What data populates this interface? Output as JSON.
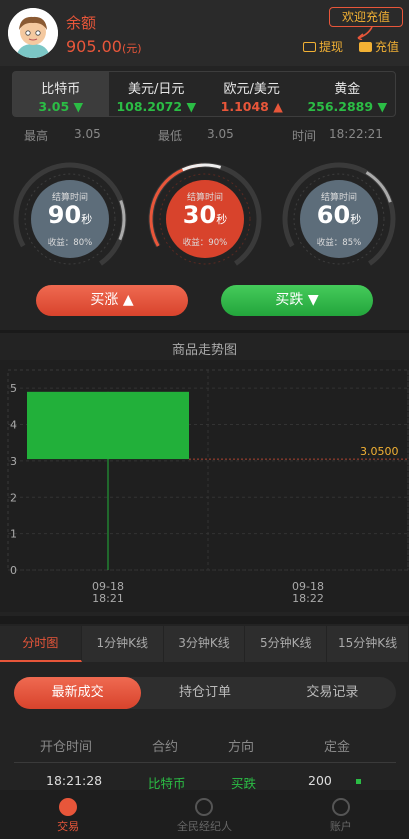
{
  "header": {
    "balance_label": "余额",
    "balance_value": "905.00",
    "balance_unit": "(元)",
    "welcome_button": "欢迎充值",
    "withdraw_label": "提现",
    "recharge_label": "充值"
  },
  "assets": [
    {
      "name": "比特币",
      "price": "3.05",
      "trend": "▼"
    },
    {
      "name": "美元/日元",
      "price": "108.2072",
      "trend": "▼"
    },
    {
      "name": "欧元/美元",
      "price": "1.1048",
      "trend": "▲"
    },
    {
      "name": "黄金",
      "price": "256.2889",
      "trend": "▼"
    }
  ],
  "stats": {
    "high_label": "最高",
    "high_value": "3.05",
    "low_label": "最低",
    "low_value": "3.05",
    "time_label": "时间",
    "time_value": "18:22:21"
  },
  "timers": [
    {
      "label": "结算时间",
      "seconds": "90",
      "unit": "秒",
      "gain": "收益：80%"
    },
    {
      "label": "结算时间",
      "seconds": "30",
      "unit": "秒",
      "gain": "收益：90%"
    },
    {
      "label": "结算时间",
      "seconds": "60",
      "unit": "秒",
      "gain": "收益：85%"
    }
  ],
  "buttons": {
    "buy_up": "买涨 ▲",
    "buy_down": "买跌 ▼"
  },
  "chart_title": "商品走势图",
  "chart_data": {
    "type": "candlestick",
    "yticks": [
      "0",
      "1",
      "2",
      "3",
      "4",
      "5"
    ],
    "ylim": [
      0,
      5.5
    ],
    "x": [
      "09-18 18:21",
      "09-18 18:22"
    ],
    "xlabels": [
      [
        "09-18",
        "18:21"
      ],
      [
        "09-18",
        "18:22"
      ]
    ],
    "candles": [
      {
        "x": "09-18 18:21",
        "open": 3.05,
        "close": 4.9,
        "low": 0,
        "high": 4.9
      }
    ],
    "current_price": 3.05,
    "current_price_label": "3.0500"
  },
  "periods": [
    "分时图",
    "1分钟K线",
    "3分钟K线",
    "5分钟K线",
    "15分钟K线"
  ],
  "trade_tabs": [
    "最新成交",
    "持仓订单",
    "交易记录"
  ],
  "table": {
    "headers": [
      "开仓时间",
      "合约",
      "方向",
      "定金"
    ],
    "rows": [
      {
        "time": "18:21:28",
        "contract": "比特币",
        "direction": "买跌",
        "deposit": "200"
      }
    ]
  },
  "nav": [
    "交易",
    "全民经纪人",
    "账户"
  ],
  "colors": {
    "accent": "#e8563a",
    "green": "#2bbd45",
    "gold": "#f2b134"
  }
}
